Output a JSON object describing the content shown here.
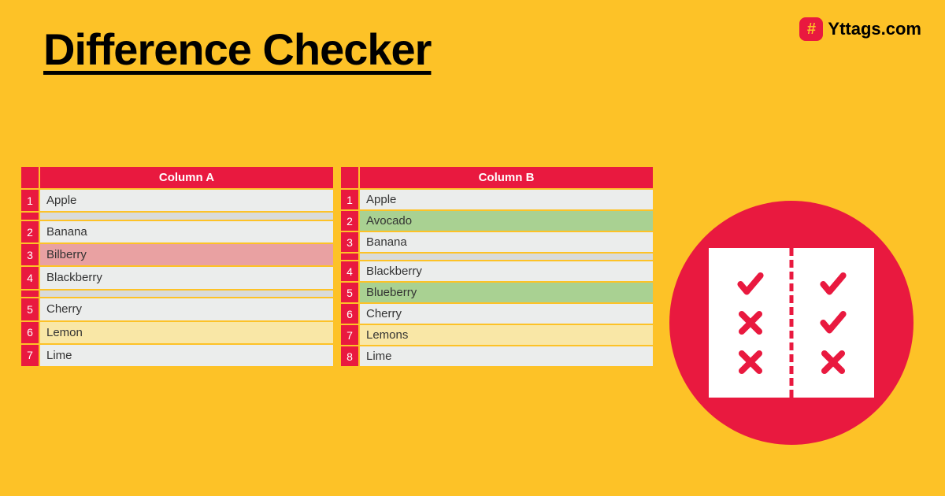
{
  "title": "Difference Checker",
  "brand": {
    "name": "Yttags.com",
    "logo_char": "#"
  },
  "colors": {
    "background": "#fdc227",
    "accent": "#e9193f",
    "row_plain": "#ebedec",
    "row_removed": "#e9a1a2",
    "row_added": "#a9d192",
    "row_changed": "#f9e7a6",
    "row_empty": "#d9dbda"
  },
  "columnA": {
    "header": "Column A",
    "rows": [
      {
        "num": "1",
        "text": "Apple",
        "status": "plain"
      },
      {
        "num": "",
        "text": "",
        "status": "empty"
      },
      {
        "num": "2",
        "text": "Banana",
        "status": "plain"
      },
      {
        "num": "3",
        "text": "Bilberry",
        "status": "removed"
      },
      {
        "num": "4",
        "text": "Blackberry",
        "status": "plain"
      },
      {
        "num": "",
        "text": "",
        "status": "empty"
      },
      {
        "num": "5",
        "text": "Cherry",
        "status": "plain"
      },
      {
        "num": "6",
        "text": "Lemon",
        "status": "changed"
      },
      {
        "num": "7",
        "text": "Lime",
        "status": "plain"
      }
    ]
  },
  "columnB": {
    "header": "Column B",
    "rows": [
      {
        "num": "1",
        "text": "Apple",
        "status": "plain"
      },
      {
        "num": "2",
        "text": "Avocado",
        "status": "added"
      },
      {
        "num": "3",
        "text": "Banana",
        "status": "plain"
      },
      {
        "num": "",
        "text": "",
        "status": "empty"
      },
      {
        "num": "4",
        "text": "Blackberry",
        "status": "plain"
      },
      {
        "num": "5",
        "text": "Blueberry",
        "status": "added"
      },
      {
        "num": "6",
        "text": "Cherry",
        "status": "plain"
      },
      {
        "num": "7",
        "text": "Lemons",
        "status": "changed"
      },
      {
        "num": "8",
        "text": "Lime",
        "status": "plain"
      }
    ]
  },
  "illustration": {
    "left_page": [
      "check",
      "x",
      "x"
    ],
    "right_page": [
      "check",
      "check",
      "x"
    ]
  }
}
